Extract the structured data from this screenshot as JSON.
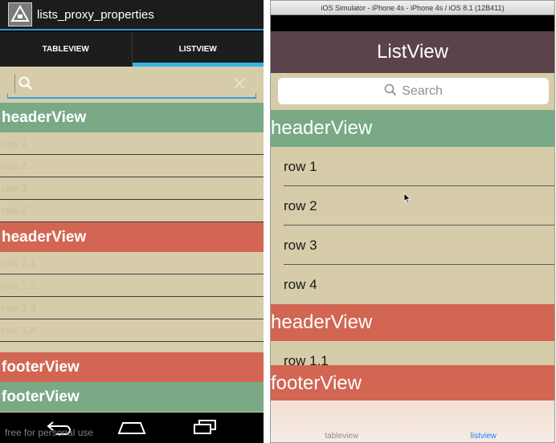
{
  "android": {
    "app_title": "lists_proxy_properties",
    "tabs": [
      {
        "label": "TABLEVIEW",
        "active": false
      },
      {
        "label": "LISTVIEW",
        "active": true
      }
    ],
    "sections": [
      {
        "header": "headerView",
        "header_color": "#79a985",
        "rows": [
          "row 1",
          "row 2",
          "row 3",
          "row 4"
        ]
      },
      {
        "header": "headerView",
        "header_color": "#d26652",
        "rows": [
          "row 1.1",
          "row 1.2",
          "row 1.3",
          "row 1.4"
        ]
      }
    ],
    "footers": [
      {
        "label": "footerView",
        "color": "#d26652"
      },
      {
        "label": "footerView",
        "color": "#79a985"
      }
    ],
    "watermark": "free for personal use",
    "accent_color": "#33b5e5"
  },
  "ios": {
    "window_title": "iOS Simulator - iPhone 4s - iPhone 4s / iOS 8.1 (12B411)",
    "nav_title": "ListView",
    "search_placeholder": "Search",
    "sections": [
      {
        "header": "headerView",
        "header_color": "#79a985",
        "rows": [
          "row 1",
          "row 2",
          "row 3",
          "row 4"
        ]
      },
      {
        "header": "headerView",
        "header_color": "#d26652",
        "rows": [
          "row 1.1"
        ]
      }
    ],
    "footer": "footerView",
    "tabs": [
      {
        "label": "tableview",
        "active": false
      },
      {
        "label": "listview",
        "active": true
      }
    ],
    "nav_color": "#5c4249",
    "active_tab_color": "#1a85ff"
  },
  "list_background": "#d6ccaa"
}
